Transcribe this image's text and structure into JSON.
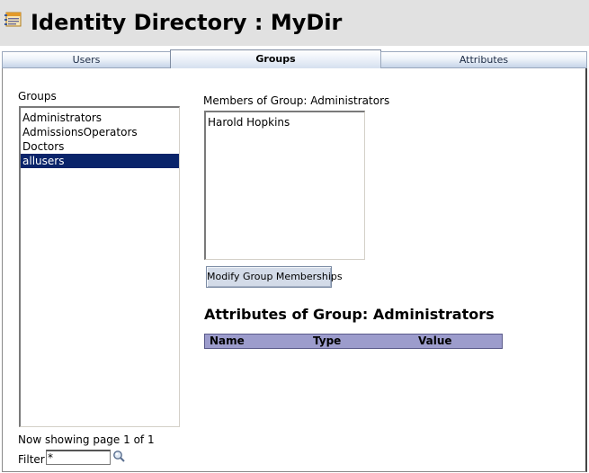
{
  "app": {
    "title": "Identity Directory : MyDir"
  },
  "tabs": [
    {
      "label": "Users",
      "active": false
    },
    {
      "label": "Groups",
      "active": true
    },
    {
      "label": "Attributes",
      "active": false
    }
  ],
  "groups_panel": {
    "label": "Groups",
    "items": [
      "Administrators",
      "AdmissionsOperators",
      "Doctors",
      "allusers"
    ],
    "selected": "allusers",
    "paging": "Now showing page 1 of 1",
    "filter_label": "Filter",
    "filter_value": "*"
  },
  "members_panel": {
    "label": "Members of Group: Administrators",
    "members": [
      "Harold Hopkins"
    ],
    "modify_button": "Modify Group Memberships"
  },
  "attributes_panel": {
    "title": "Attributes of Group: Administrators",
    "columns": [
      "Name",
      "Type",
      "Value"
    ]
  },
  "icons": {
    "app": "directory-book-icon",
    "search": "magnifier-search-icon"
  },
  "colors": {
    "selection": "#0a246a",
    "table_header": "#9c9ccc",
    "header_bg": "#e1e1e1"
  }
}
